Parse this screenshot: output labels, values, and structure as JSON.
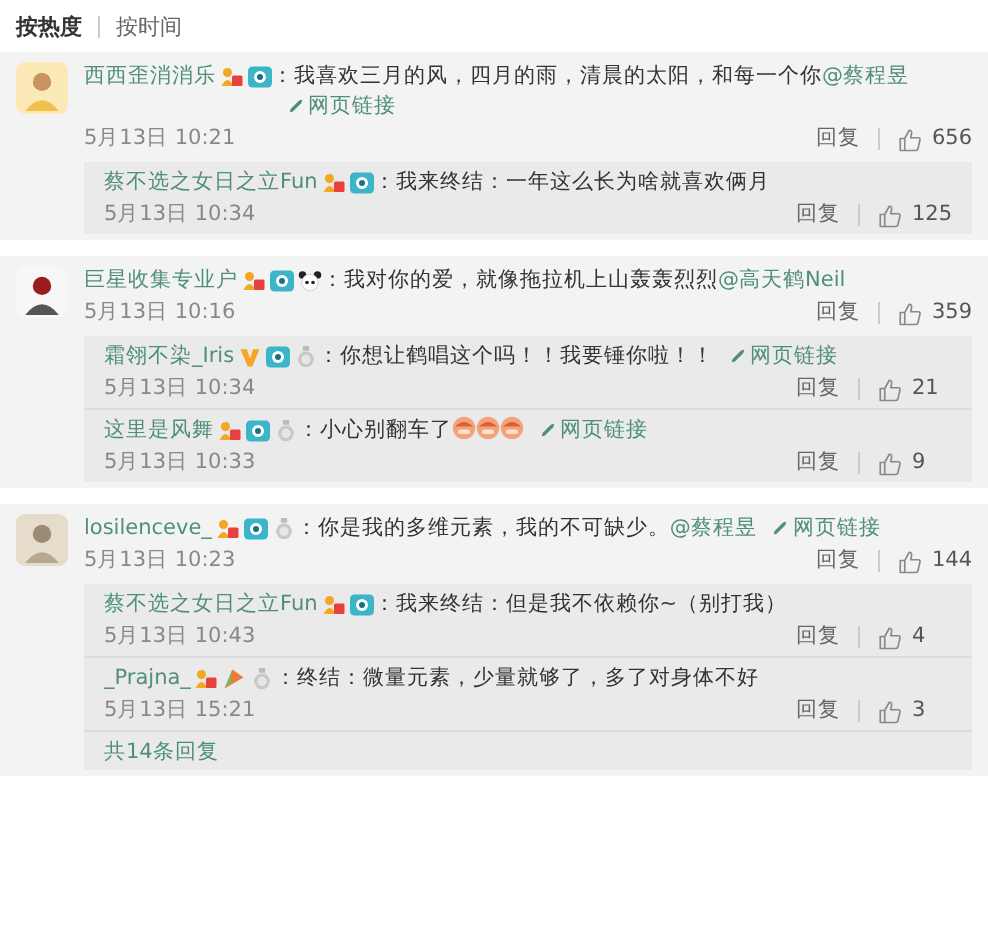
{
  "sort_tabs": [
    {
      "label": "按热度",
      "selected": true
    },
    {
      "label": "按时间",
      "selected": false
    }
  ],
  "comments": [
    {
      "user": "西西歪消消乐",
      "badges": [
        {
          "kind": "level"
        },
        {
          "kind": "camera"
        }
      ],
      "segments": [
        {
          "kind": "text",
          "text": "：我喜欢三月的风，四月的雨，清晨的太阳，和每一个你"
        },
        {
          "kind": "mention",
          "text": "@蔡程昱"
        },
        {
          "kind": "link",
          "text": "网页链接"
        }
      ],
      "time": "5月13日 10:21",
      "reply": "回复",
      "likes": "656",
      "replies": [
        {
          "user": "蔡不选之女日之立Fun",
          "badges": [
            {
              "kind": "level"
            },
            {
              "kind": "camera"
            }
          ],
          "segments": [
            {
              "kind": "text",
              "text": "：我来终结：一年这么长为啥就喜欢俩月"
            }
          ],
          "time": "5月13日 10:34",
          "reply": "回复",
          "likes": "125"
        }
      ]
    },
    {
      "user": "巨星收集专业户",
      "badges": [
        {
          "kind": "level"
        },
        {
          "kind": "camera"
        },
        {
          "kind": "panda"
        }
      ],
      "segments": [
        {
          "kind": "text",
          "text": "：我对你的爱，就像拖拉机上山轰轰烈烈"
        },
        {
          "kind": "mention",
          "text": "@高天鹤Neil"
        }
      ],
      "time": "5月13日 10:16",
      "reply": "回复",
      "likes": "359",
      "replies": [
        {
          "user": "霜翎不染_Iris",
          "badges": [
            {
              "kind": "vip"
            },
            {
              "kind": "camera"
            },
            {
              "kind": "medal"
            }
          ],
          "segments": [
            {
              "kind": "text",
              "text": "：你想让鹤唱这个吗！！我要锤你啦！！"
            },
            {
              "kind": "link",
              "text": "网页链接"
            }
          ],
          "time": "5月13日 10:34",
          "reply": "回复",
          "likes": "21"
        },
        {
          "user": "这里是风舞",
          "badges": [
            {
              "kind": "level"
            },
            {
              "kind": "camera"
            },
            {
              "kind": "medal"
            }
          ],
          "segments": [
            {
              "kind": "text",
              "text": "：小心别翻车了"
            },
            {
              "kind": "emoji"
            },
            {
              "kind": "emoji"
            },
            {
              "kind": "emoji"
            },
            {
              "kind": "link",
              "text": "网页链接"
            }
          ],
          "time": "5月13日 10:33",
          "reply": "回复",
          "likes": "9"
        }
      ]
    },
    {
      "user": "losilenceve_",
      "badges": [
        {
          "kind": "level"
        },
        {
          "kind": "camera"
        },
        {
          "kind": "medal"
        }
      ],
      "segments": [
        {
          "kind": "text",
          "text": "：你是我的多维元素，我的不可缺少。"
        },
        {
          "kind": "mention",
          "text": "@蔡程昱"
        },
        {
          "kind": "link",
          "text": "网页链接"
        }
      ],
      "time": "5月13日 10:23",
      "reply": "回复",
      "likes": "144",
      "replies": [
        {
          "user": "蔡不选之女日之立Fun",
          "badges": [
            {
              "kind": "level"
            },
            {
              "kind": "camera"
            }
          ],
          "segments": [
            {
              "kind": "text",
              "text": "：我来终结：但是我不依赖你~（别打我）"
            }
          ],
          "time": "5月13日 10:43",
          "reply": "回复",
          "likes": "4"
        },
        {
          "user": "_Prajna_",
          "badges": [
            {
              "kind": "level"
            },
            {
              "kind": "flag"
            },
            {
              "kind": "medal"
            }
          ],
          "segments": [
            {
              "kind": "text",
              "text": "：终结：微量元素，少量就够了，多了对身体不好"
            }
          ],
          "time": "5月13日 15:21",
          "reply": "回复",
          "likes": "3"
        }
      ],
      "more_replies": "共14条回复"
    }
  ]
}
